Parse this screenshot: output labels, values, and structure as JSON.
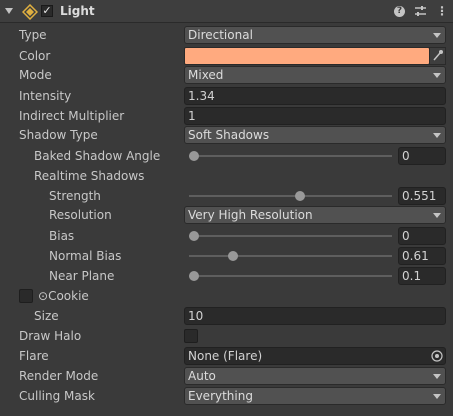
{
  "header": {
    "title": "Light",
    "enabled_glyph": "✓"
  },
  "icons": {
    "fold": "triangle-down",
    "component": "light-icon",
    "help": "?",
    "preset": "sliders-icon",
    "menu": "⋮"
  },
  "colors": {
    "light_color": "#FFAA7F"
  },
  "fields": {
    "type": {
      "label": "Type",
      "value": "Directional"
    },
    "color": {
      "label": "Color"
    },
    "mode": {
      "label": "Mode",
      "value": "Mixed"
    },
    "intensity": {
      "label": "Intensity",
      "value": "1.34"
    },
    "indirect_multiplier": {
      "label": "Indirect Multiplier",
      "value": "1"
    },
    "shadow_type": {
      "label": "Shadow Type",
      "value": "Soft Shadows"
    },
    "baked_shadow_angle": {
      "label": "Baked Shadow Angle",
      "value": "0",
      "fraction": 0.0
    },
    "realtime_shadows": {
      "label": "Realtime Shadows"
    },
    "strength": {
      "label": "Strength",
      "value": "0.551",
      "fraction": 0.551
    },
    "resolution": {
      "label": "Resolution",
      "value": "Very High Resolution"
    },
    "bias": {
      "label": "Bias",
      "value": "0",
      "fraction": 0.0
    },
    "normal_bias": {
      "label": "Normal Bias",
      "value": "0.61",
      "fraction": 0.203
    },
    "near_plane": {
      "label": "Near Plane",
      "value": "0.1",
      "fraction": 0.0
    },
    "cookie": {
      "label": "Cookie",
      "prefix": "⊙"
    },
    "size": {
      "label": "Size",
      "value": "10"
    },
    "draw_halo": {
      "label": "Draw Halo",
      "checked": false
    },
    "flare": {
      "label": "Flare",
      "value": "None (Flare)"
    },
    "render_mode": {
      "label": "Render Mode",
      "value": "Auto"
    },
    "culling_mask": {
      "label": "Culling Mask",
      "value": "Everything"
    }
  }
}
